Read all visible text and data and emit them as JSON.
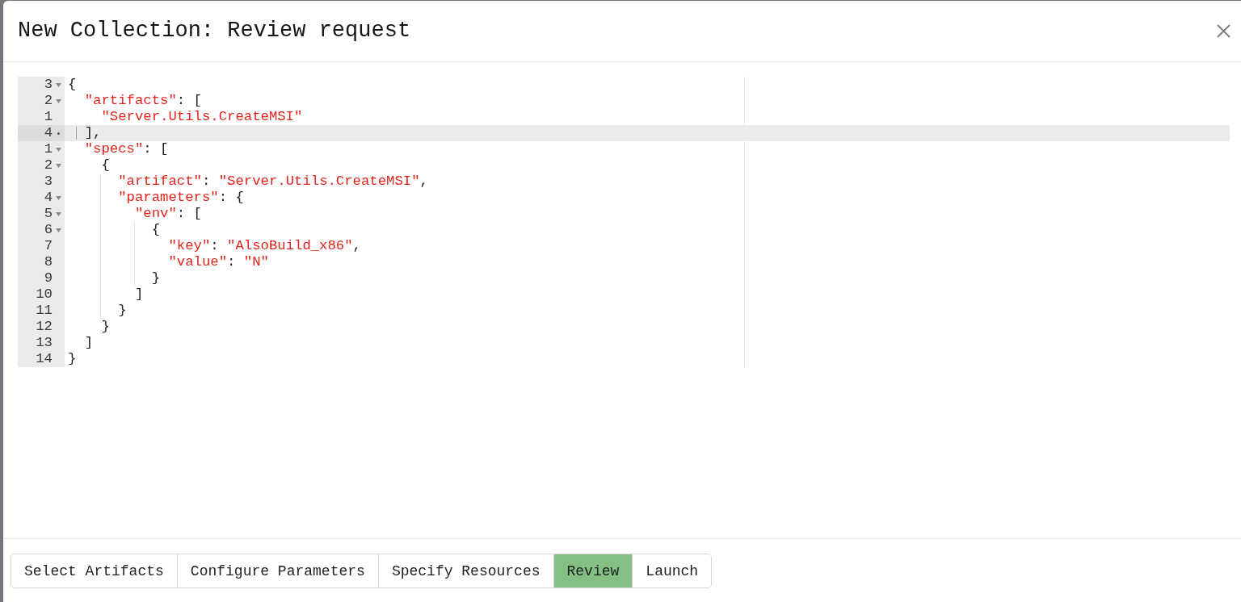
{
  "dialog": {
    "title": "New Collection: Review request"
  },
  "editor": {
    "lines": [
      {
        "number": "3",
        "kind": "foldable",
        "active": false,
        "text": "{"
      },
      {
        "number": "2",
        "kind": "foldable",
        "active": false,
        "text": "  \"artifacts\": ["
      },
      {
        "number": "1",
        "kind": "plain",
        "active": false,
        "text": "    \"Server.Utils.CreateMSI\""
      },
      {
        "number": "4",
        "kind": "closing",
        "active": true,
        "text": "  ],"
      },
      {
        "number": "1",
        "kind": "foldable",
        "active": false,
        "text": "  \"specs\": ["
      },
      {
        "number": "2",
        "kind": "foldable",
        "active": false,
        "text": "    {"
      },
      {
        "number": "3",
        "kind": "plain",
        "active": false,
        "text": "      \"artifact\": \"Server.Utils.CreateMSI\","
      },
      {
        "number": "4",
        "kind": "foldable",
        "active": false,
        "text": "      \"parameters\": {"
      },
      {
        "number": "5",
        "kind": "foldable",
        "active": false,
        "text": "        \"env\": ["
      },
      {
        "number": "6",
        "kind": "foldable",
        "active": false,
        "text": "          {"
      },
      {
        "number": "7",
        "kind": "plain",
        "active": false,
        "text": "            \"key\": \"AlsoBuild_x86\","
      },
      {
        "number": "8",
        "kind": "plain",
        "active": false,
        "text": "            \"value\": \"N\""
      },
      {
        "number": "9",
        "kind": "plain",
        "active": false,
        "text": "          }"
      },
      {
        "number": "10",
        "kind": "plain",
        "active": false,
        "text": "        ]"
      },
      {
        "number": "11",
        "kind": "plain",
        "active": false,
        "text": "      }"
      },
      {
        "number": "12",
        "kind": "plain",
        "active": false,
        "text": "    }"
      },
      {
        "number": "13",
        "kind": "plain",
        "active": false,
        "text": "  ]"
      },
      {
        "number": "14",
        "kind": "plain",
        "active": false,
        "text": "}"
      }
    ]
  },
  "steps": [
    {
      "label": "Select Artifacts",
      "selected": false
    },
    {
      "label": "Configure Parameters",
      "selected": false
    },
    {
      "label": "Specify Resources",
      "selected": false
    },
    {
      "label": "Review",
      "selected": true
    },
    {
      "label": "Launch",
      "selected": false
    }
  ]
}
